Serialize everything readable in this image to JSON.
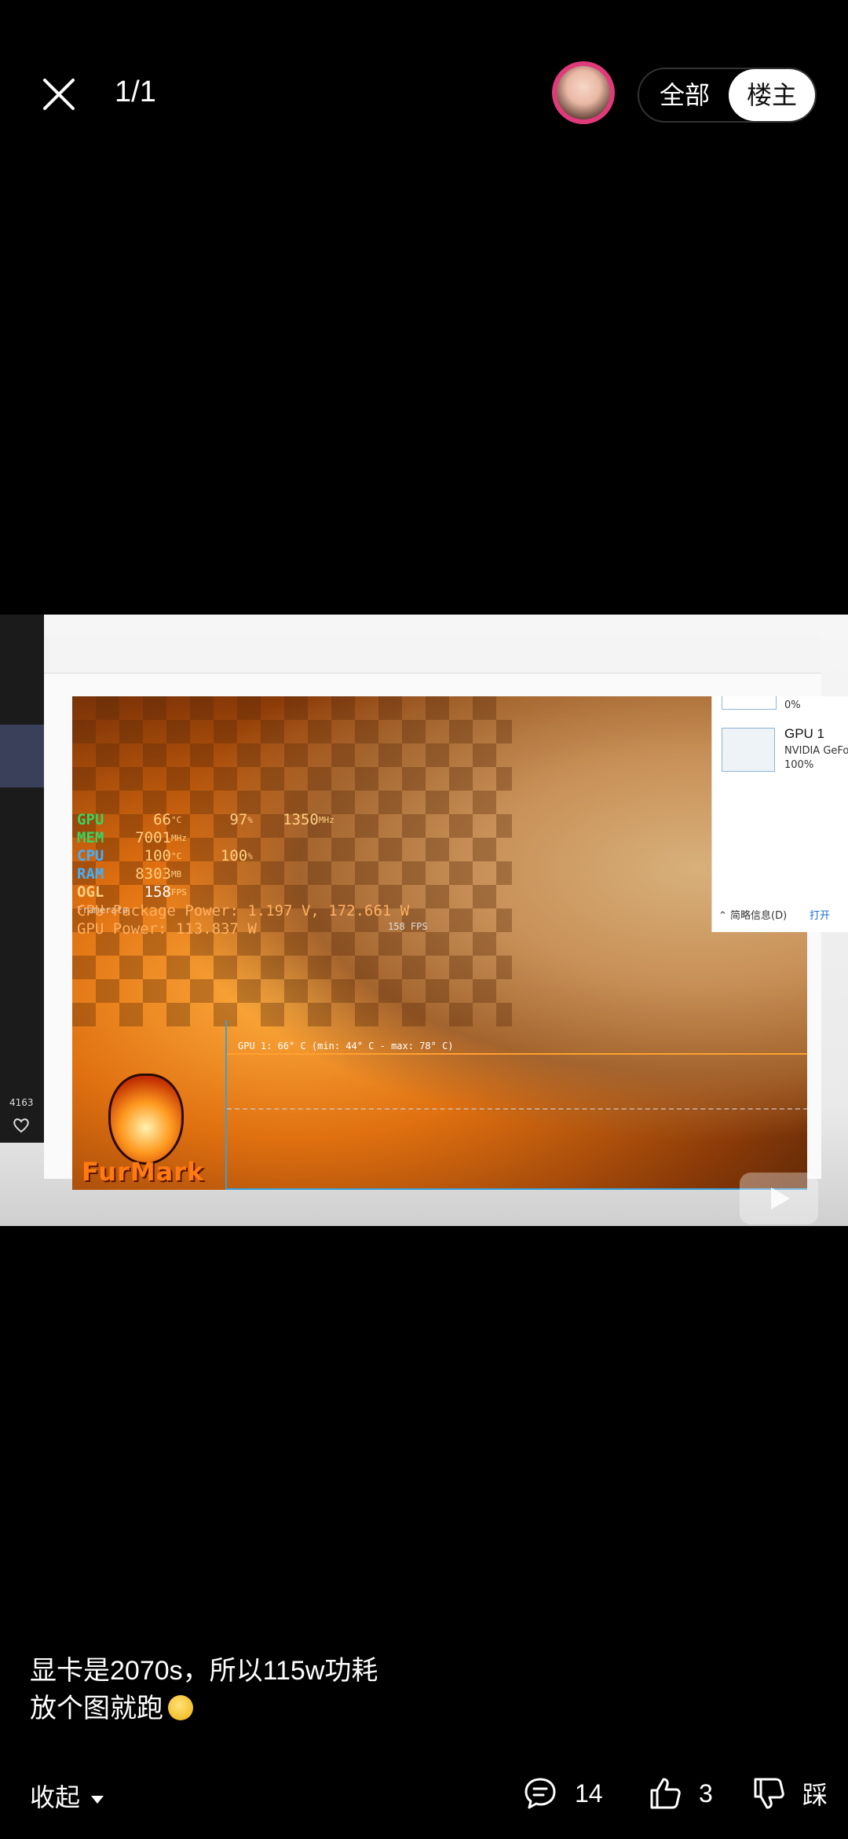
{
  "header": {
    "counter": "1/1",
    "filter_all": "全部",
    "filter_op": "楼主"
  },
  "photo": {
    "osd": {
      "rows": [
        {
          "key": "GPU",
          "v1": "66",
          "u1": "°C",
          "v2": "97",
          "u2": "%",
          "v3": "1350",
          "u3": "MHz"
        },
        {
          "key": "MEM",
          "v1": "7001",
          "u1": "MHz"
        },
        {
          "key": "CPU",
          "v1": "100",
          "u1": "°C",
          "v2": "100",
          "u2": "%"
        },
        {
          "key": "RAM",
          "v1": "8303",
          "u1": "MB"
        },
        {
          "key": "OGL",
          "v1": "158",
          "u1": "FPS"
        }
      ],
      "framerate_label": "Framerate",
      "fps_tag": "158 FPS"
    },
    "power": {
      "cpu": "CPU Package Power: 1.197 V, 172.661 W",
      "gpu": "GPU Power: 113.837 W"
    },
    "graph_label": "GPU 1: 66° C (min: 44° C - max: 78° C)",
    "logo_text": "FurMark",
    "side_panel": {
      "pct_top": "0%",
      "gpu_title": "GPU 1",
      "gpu_name": "NVIDIA GeFo",
      "gpu_pct": "100%",
      "brief": "简略信息(D)",
      "open": "打开"
    },
    "phone_count": "4163"
  },
  "caption": {
    "line1": "显卡是2070s，所以115w功耗",
    "line2": "放个图就跑"
  },
  "footer": {
    "collapse": "收起",
    "comments": "14",
    "likes": "3",
    "dislike": "踩"
  }
}
